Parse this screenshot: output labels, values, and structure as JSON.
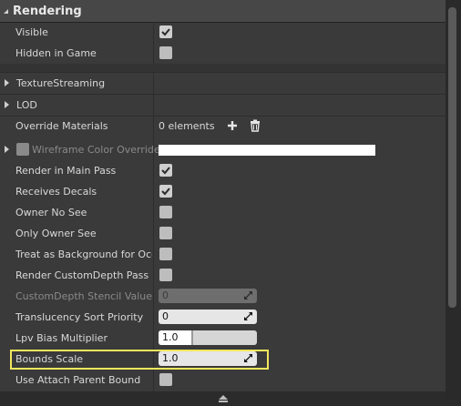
{
  "section": {
    "title": "Rendering"
  },
  "rows_top": [
    {
      "label": "Visible",
      "checked": true
    },
    {
      "label": "Hidden in Game",
      "checked": false
    }
  ],
  "categories": [
    {
      "label": "TextureStreaming"
    },
    {
      "label": "LOD"
    }
  ],
  "override_materials": {
    "label": "Override Materials",
    "value": "0 elements"
  },
  "wireframe": {
    "label": "Wireframe Color Override",
    "color": "#ffffff"
  },
  "bool_rows": [
    {
      "label": "Render in Main Pass",
      "checked": true
    },
    {
      "label": "Receives Decals",
      "checked": true
    },
    {
      "label": "Owner No See",
      "checked": false
    },
    {
      "label": "Only Owner See",
      "checked": false
    },
    {
      "label": "Treat as Background for Occlu",
      "checked": false
    },
    {
      "label": "Render CustomDepth Pass",
      "checked": false
    }
  ],
  "num_rows": [
    {
      "label": "CustomDepth Stencil Value",
      "value": "0",
      "disabled": true
    },
    {
      "label": "Translucency Sort Priority",
      "value": "0",
      "disabled": false
    },
    {
      "label": "Lpv Bias Multiplier",
      "value": "1.0",
      "slider": true
    },
    {
      "label": "Bounds Scale",
      "value": "1.0",
      "disabled": false
    }
  ],
  "use_attach": {
    "label": "Use Attach Parent Bound",
    "checked": false
  },
  "colors": {
    "highlight": "#f1e75d",
    "panel": "#3a3a3a"
  }
}
